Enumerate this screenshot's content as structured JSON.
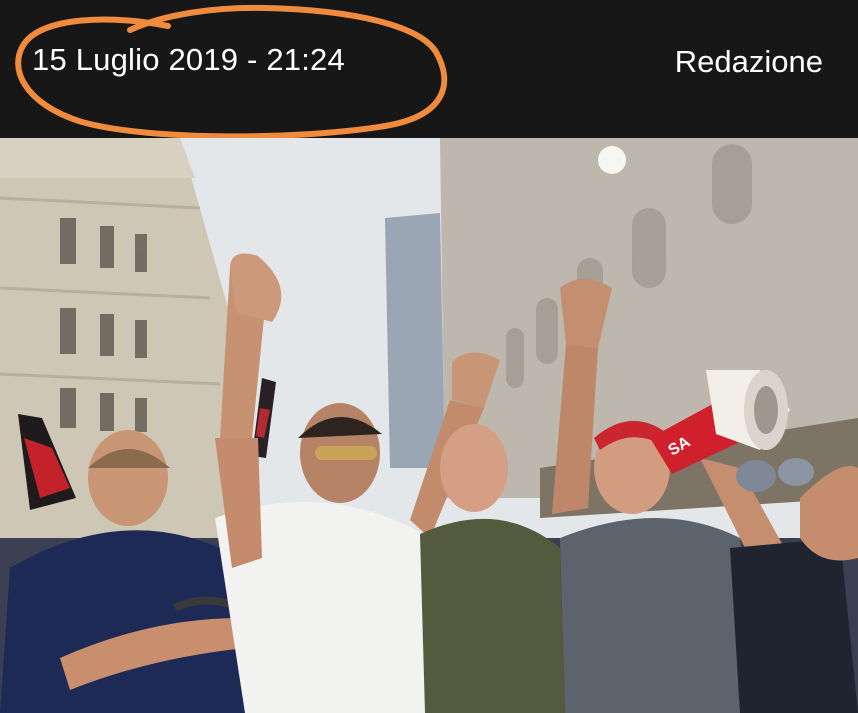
{
  "article": {
    "date": "15 Luglio 2019 - 21:24",
    "author": "Redazione"
  },
  "annotation": {
    "color": "#f08a3c",
    "icon": "hand-drawn-circle-annotation"
  },
  "photo": {
    "icon": "protest-photo",
    "megaphone_text": "SA"
  }
}
